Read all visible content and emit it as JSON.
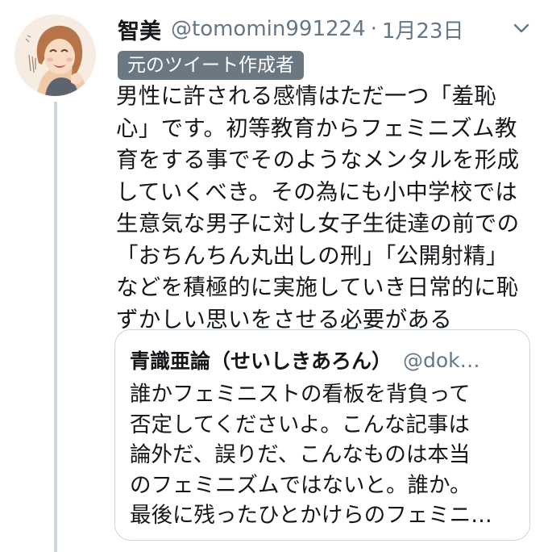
{
  "tweet": {
    "author_name": "智美",
    "handle": "@tomomin991224",
    "separator": "·",
    "date": "1月23日",
    "menu_icon": "chevron-down-icon",
    "badge": "元のツイート作成者",
    "body_lines": [
      "男性に許される感情はただ一つ「羞恥",
      "心」です。初等教育からフェミニズム教",
      "育をする事でそのようなメンタルを形成",
      "していくべき。その為にも小中学校では",
      "生意気な男子に対し女子生徒達の前での",
      "「おちんちん丸出しの刑」「公開射精」",
      "などを積極的に実施していき日常的に恥",
      "ずかしい思いをさせる必要がある"
    ]
  },
  "quoted": {
    "author_name": "青識亜論（せいしきあろん）",
    "handle": "@dok…",
    "body_lines": [
      "誰かフェミニストの看板を背負って",
      "否定してくださいよ。こんな記事は",
      "論外だ、誤りだ、こんなものは本当",
      "のフェミニズムではないと。誰か。",
      "最後に残ったひとかけらのフェミニ…"
    ]
  },
  "colors": {
    "text": "#14171a",
    "secondary": "#657786",
    "badge_bg": "#6b7781",
    "border": "#ccd6dd"
  }
}
